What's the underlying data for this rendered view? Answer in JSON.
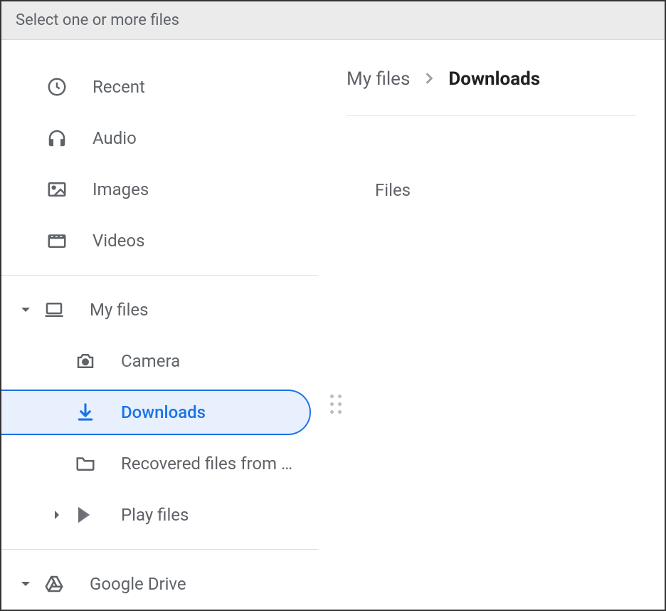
{
  "titlebar": "Select one or more files",
  "sidebar": {
    "quick": [
      {
        "label": "Recent"
      },
      {
        "label": "Audio"
      },
      {
        "label": "Images"
      },
      {
        "label": "Videos"
      }
    ],
    "my_files": {
      "label": "My files",
      "children": [
        {
          "label": "Camera"
        },
        {
          "label": "Downloads"
        },
        {
          "label": "Recovered files from …"
        },
        {
          "label": "Play files"
        }
      ]
    },
    "google_drive": {
      "label": "Google Drive"
    }
  },
  "main": {
    "breadcrumb": {
      "parent": "My files",
      "current": "Downloads"
    },
    "section_header": "Files"
  }
}
